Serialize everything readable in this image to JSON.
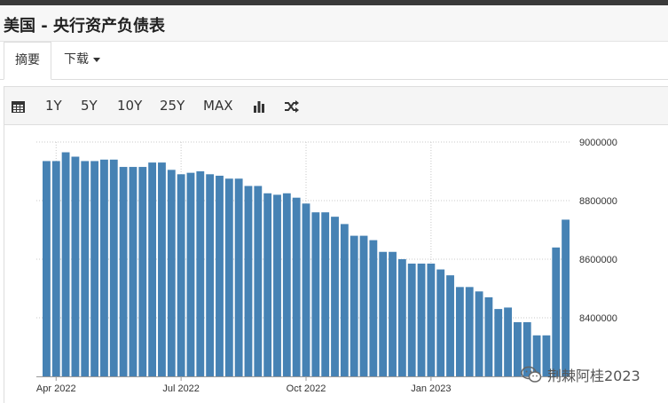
{
  "header": {
    "title": "美国 - 央行资产负债表"
  },
  "tabs": [
    {
      "label": "摘要"
    },
    {
      "label": "下载"
    }
  ],
  "toolbar": {
    "calendar_icon": "calendar-icon",
    "ranges": [
      "1Y",
      "5Y",
      "10Y",
      "25Y",
      "MAX"
    ],
    "bar_chart_icon": "bar-chart-icon",
    "random_icon": "shuffle-icon"
  },
  "watermark": {
    "text": "荆棘阿桂2023",
    "icon": "wechat-icon"
  },
  "chart_data": {
    "type": "bar",
    "color": "#4682b4",
    "xlabel": "",
    "ylabel": "",
    "x_tick_labels": [
      "Apr 2022",
      "Jul 2022",
      "Oct 2022",
      "Jan 2023"
    ],
    "y_tick_labels": [
      "8400000",
      "8600000",
      "8800000",
      "9000000"
    ],
    "y_ticks": [
      8400000,
      8600000,
      8800000,
      9000000
    ],
    "ylim": [
      8200000,
      9000000
    ],
    "grid": "vertical dotted at month ticks, horizontal dotted at y ticks",
    "frequency": "weekly",
    "start_label": "Apr 2022",
    "values": [
      8935000,
      8935000,
      8965000,
      8950000,
      8935000,
      8935000,
      8940000,
      8940000,
      8915000,
      8915000,
      8915000,
      8930000,
      8930000,
      8905000,
      8890000,
      8895000,
      8900000,
      8890000,
      8885000,
      8875000,
      8875000,
      8850000,
      8850000,
      8825000,
      8820000,
      8825000,
      8810000,
      8790000,
      8760000,
      8760000,
      8745000,
      8720000,
      8680000,
      8680000,
      8665000,
      8625000,
      8625000,
      8600000,
      8585000,
      8585000,
      8585000,
      8565000,
      8545000,
      8505000,
      8505000,
      8490000,
      8470000,
      8430000,
      8435000,
      8385000,
      8385000,
      8340000,
      8340000,
      8640000,
      8735000
    ]
  }
}
